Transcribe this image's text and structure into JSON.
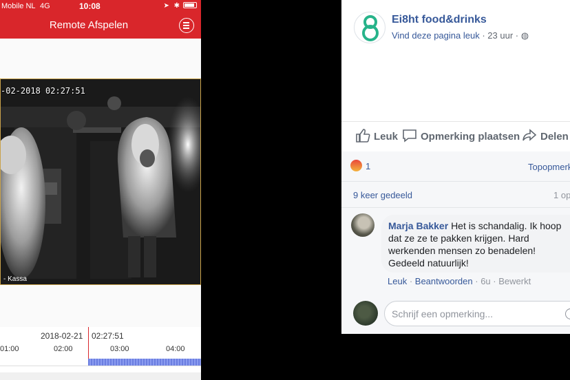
{
  "colors": {
    "accent_red": "#d9262b",
    "fb_blue": "#365899",
    "timeline_bar": "#6b7ee0"
  },
  "left_app": {
    "status": {
      "carrier": "Mobile NL",
      "network": "4G",
      "time": "10:08"
    },
    "title": "Remote Afspelen",
    "video": {
      "timestamp": "-02-2018 02:27:51",
      "camera_label": "- Kassa"
    },
    "timeline": {
      "date": "2018-02-21",
      "cursor_time": "02:27:51",
      "ticks": [
        "01:00",
        "02:00",
        "03:00",
        "04:00"
      ]
    }
  },
  "facebook": {
    "page_name": "Ei8ht food&drinks",
    "like_link": "Vind deze pagina leuk",
    "time_ago": "23 uur",
    "actions": {
      "like": "Leuk",
      "comment": "Opmerking plaatsen",
      "share": "Delen"
    },
    "reaction_count": "1",
    "top_comments": "Topopmerk",
    "share_count": "9 keer gedeeld",
    "page_of": "1 op",
    "comment": {
      "author": "Marja Bakker",
      "text": "Het is schandalig. Ik hoop dat ze ze te pakken krijgen. Hard werkenden mensen zo benadelen! Gedeeld natuurlijk!",
      "like": "Leuk",
      "reply": "Beantwoorden",
      "time": "6u",
      "edited": "Bewerkt"
    },
    "write_placeholder": "Schrijf een opmerking..."
  }
}
